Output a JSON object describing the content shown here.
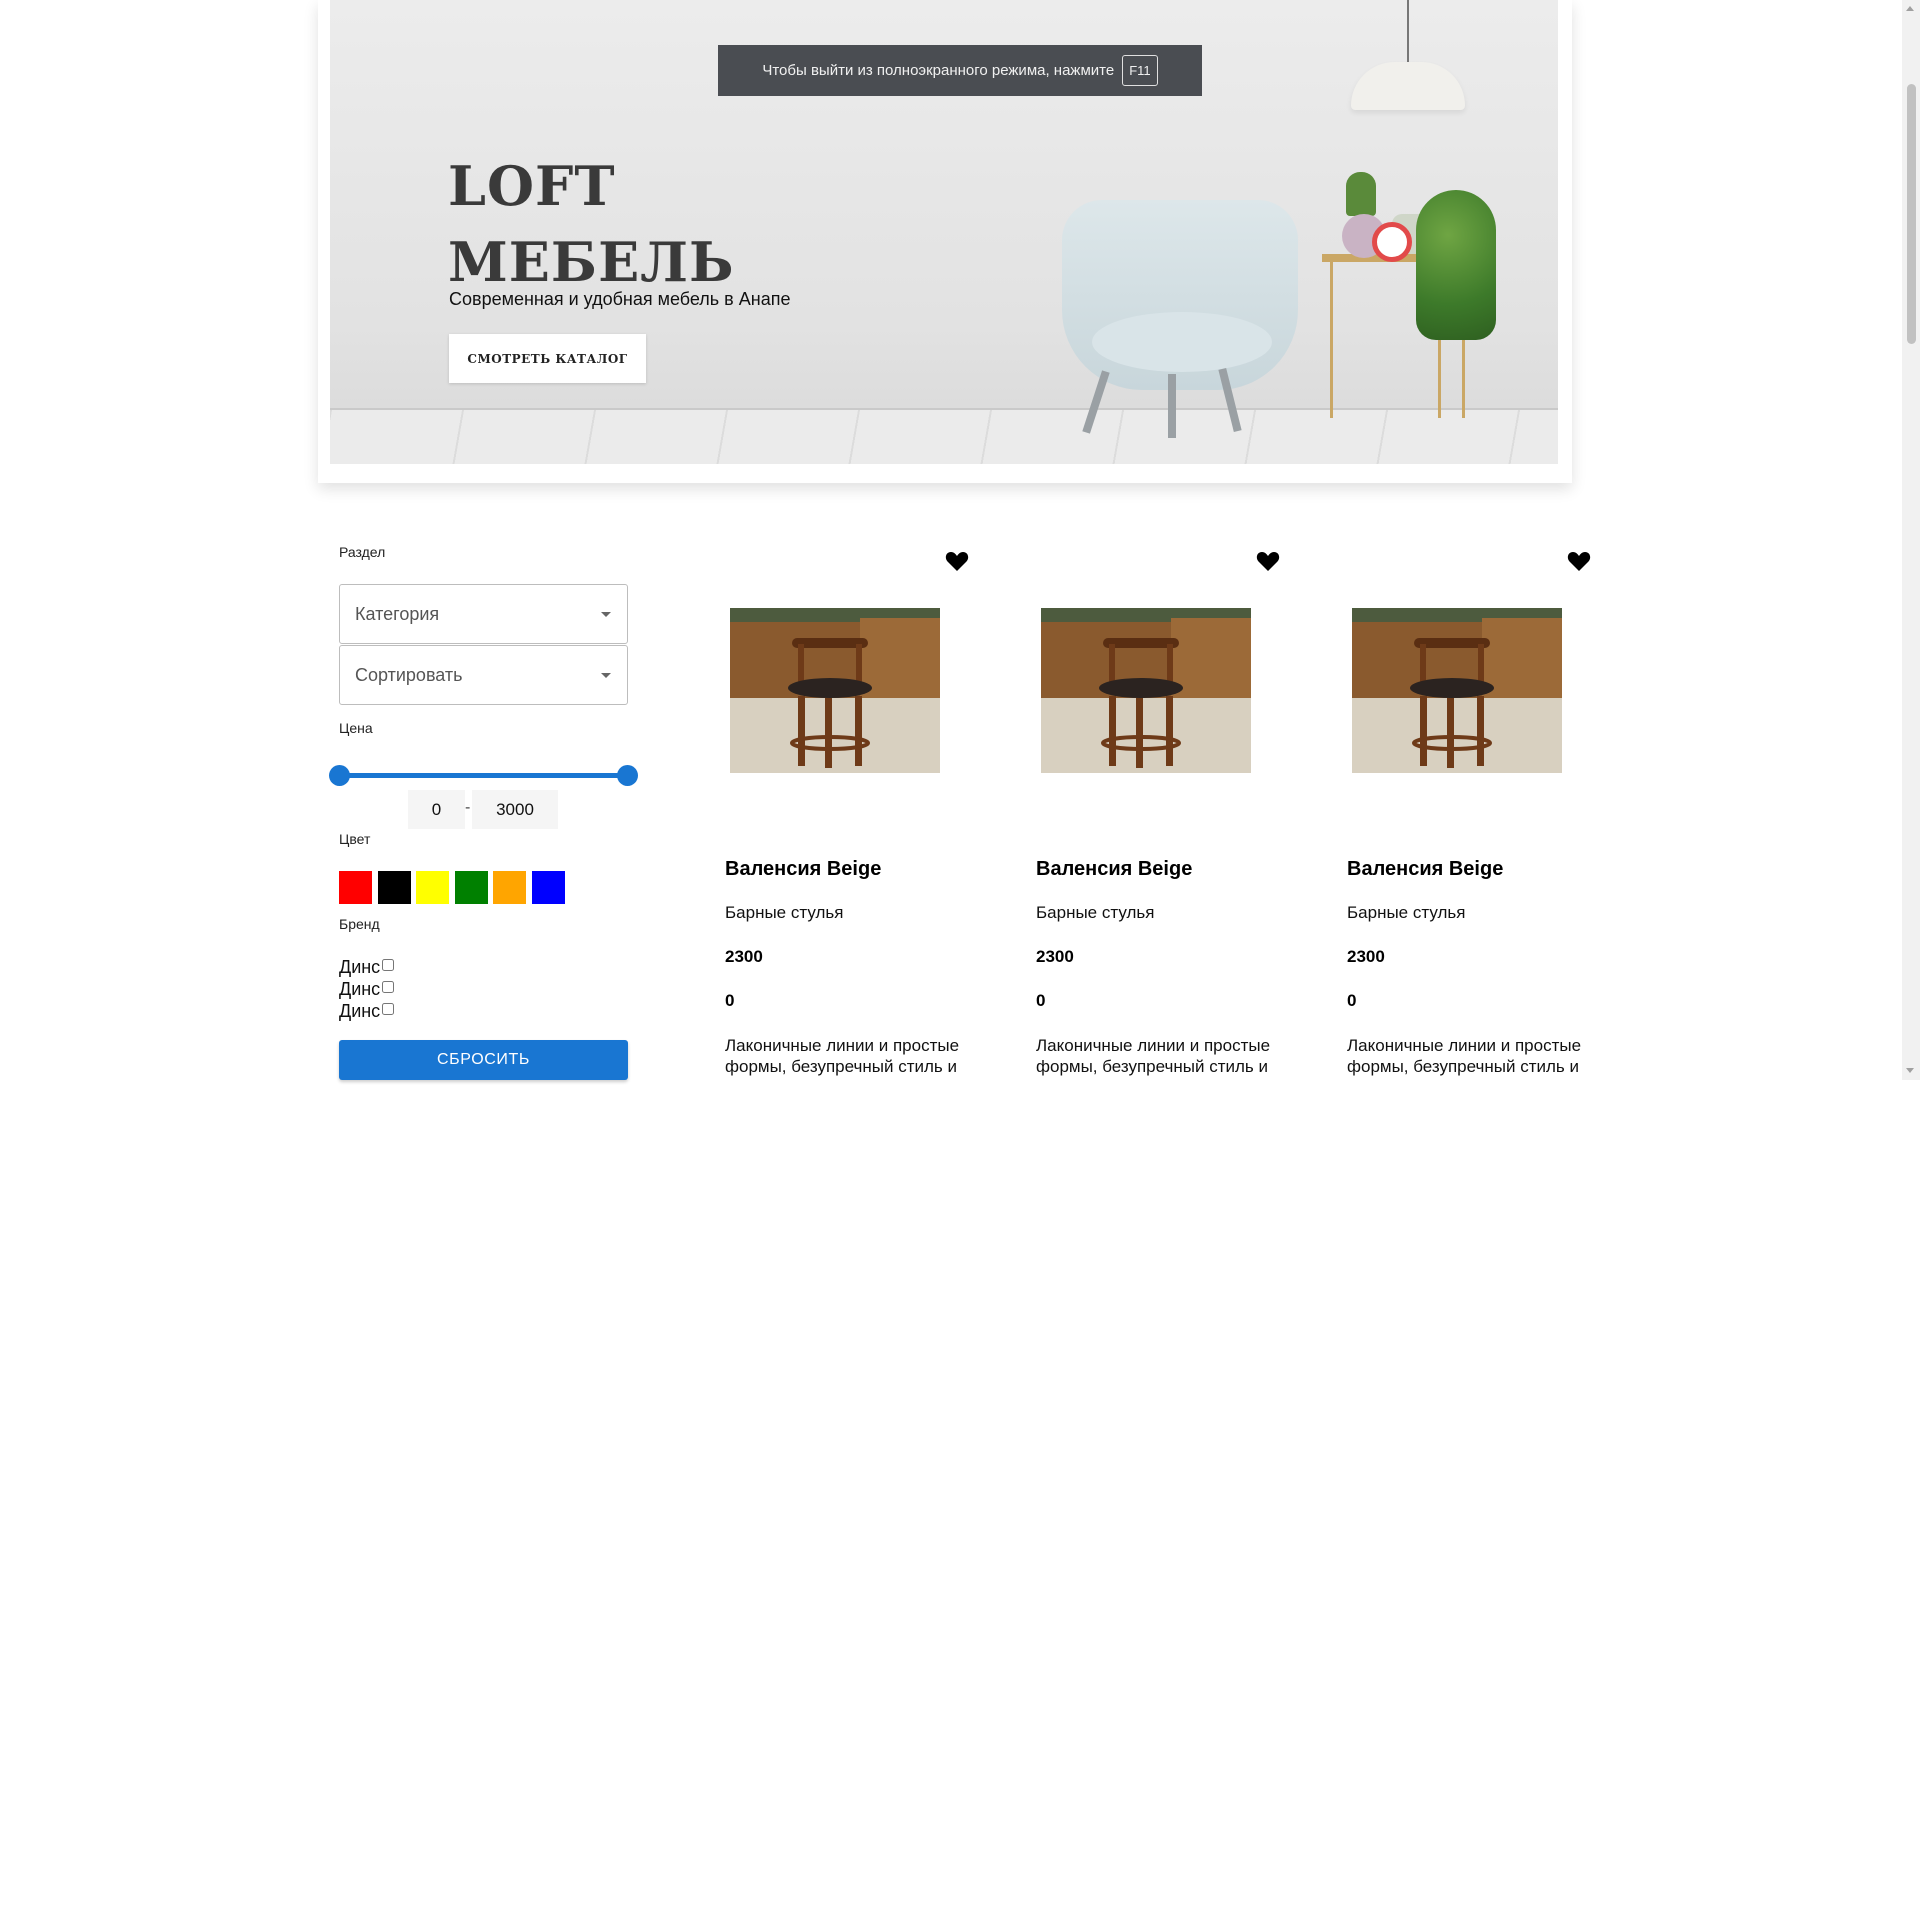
{
  "fullscreen_notice": {
    "text": "Чтобы выйти из полноэкранного режима, нажмите",
    "key": "F11"
  },
  "hero": {
    "title_line1": "LOFT",
    "title_line2": "МЕБЕЛЬ",
    "subtitle": "Современная и удобная мебель в Анапе",
    "cta_label": "СМОТРЕТЬ КАТАЛОГ"
  },
  "filters": {
    "section_label": "Раздел",
    "category_placeholder": "Категория",
    "sort_placeholder": "Сортировать",
    "price_label": "Цена",
    "price_min": "0",
    "price_dash": "-",
    "price_max": "3000",
    "color_label": "Цвет",
    "colors": [
      {
        "name": "red",
        "hex": "#ff0000"
      },
      {
        "name": "black",
        "hex": "#000000"
      },
      {
        "name": "yellow",
        "hex": "#ffff00"
      },
      {
        "name": "green",
        "hex": "#008000"
      },
      {
        "name": "orange",
        "hex": "#ffa500"
      },
      {
        "name": "blue",
        "hex": "#0000ff"
      }
    ],
    "brand_label": "Бренд",
    "brands": [
      "Динс",
      "Динс",
      "Динс"
    ],
    "reset_label": "СБРОСИТЬ"
  },
  "products": [
    {
      "name": "Валенсия Beige",
      "category": "Барные стулья",
      "price": "2300",
      "stock": "0",
      "description": "Лаконичные линии и простые формы, безупречный стиль и"
    },
    {
      "name": "Валенсия Beige",
      "category": "Барные стулья",
      "price": "2300",
      "stock": "0",
      "description": "Лаконичные линии и простые формы, безупречный стиль и"
    },
    {
      "name": "Валенсия Beige",
      "category": "Барные стулья",
      "price": "2300",
      "stock": "0",
      "description": "Лаконичные линии и простые формы, безупречный стиль и"
    }
  ],
  "theme": {
    "accent": "#1976d2"
  }
}
